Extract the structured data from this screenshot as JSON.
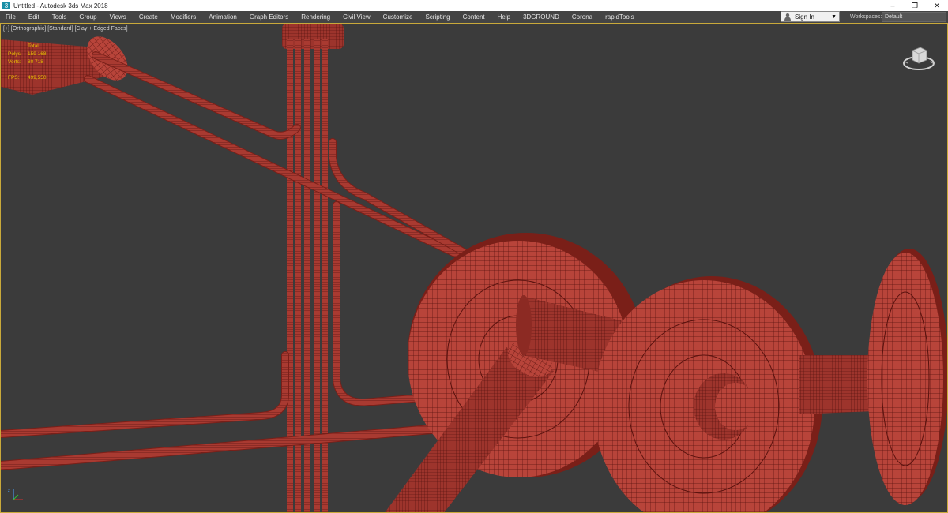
{
  "window": {
    "title": "Untitled - Autodesk 3ds Max 2018",
    "app_icon": "3dsmax-icon",
    "controls": {
      "minimize": "–",
      "restore": "❐",
      "close": "✕"
    }
  },
  "menu": {
    "items": [
      "File",
      "Edit",
      "Tools",
      "Group",
      "Views",
      "Create",
      "Modifiers",
      "Animation",
      "Graph Editors",
      "Rendering",
      "Civil View",
      "Customize",
      "Scripting",
      "Content",
      "Help",
      "3DGROUND",
      "Corona",
      "rapidTools"
    ],
    "signin_label": "Sign In",
    "workspaces_label": "Workspaces:",
    "workspace_value": "Default"
  },
  "viewport": {
    "label": "[+] [Orthographic] [Standard] [Clay + Edged Faces]",
    "stats": {
      "header": "Total",
      "polys_label": "Polys:",
      "polys_value": "159 168",
      "verts_label": "Verts:",
      "verts_value": "80 718",
      "fps_label": "FPS:",
      "fps_value": "499,550"
    }
  },
  "colors": {
    "viewport_bg": "#3b3b3b",
    "clay": "#b8443a",
    "clay_dark": "#7a1f18",
    "wire": "#4a0d0a",
    "stats_text": "#e8c000"
  }
}
